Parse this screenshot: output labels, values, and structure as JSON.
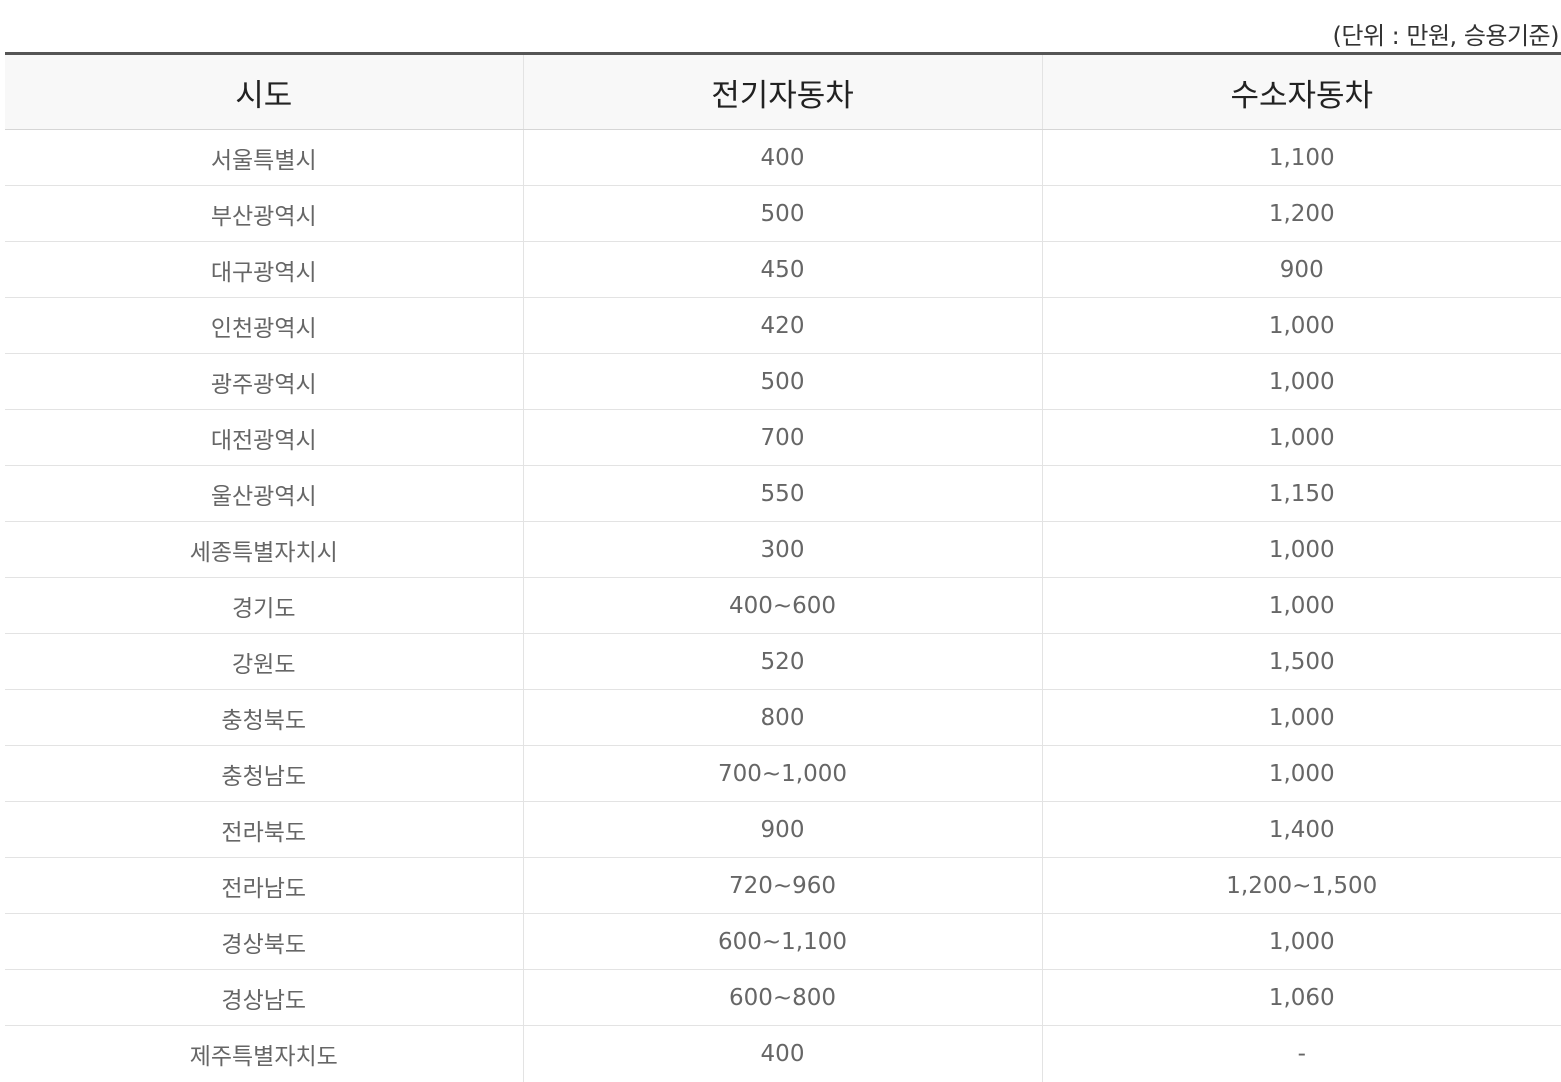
{
  "unit_note": "(단위 : 만원, 승용기준)",
  "table": {
    "headers": [
      "시도",
      "전기자동차",
      "수소자동차"
    ],
    "rows": [
      [
        "서울특별시",
        "400",
        "1,100"
      ],
      [
        "부산광역시",
        "500",
        "1,200"
      ],
      [
        "대구광역시",
        "450",
        "900"
      ],
      [
        "인천광역시",
        "420",
        "1,000"
      ],
      [
        "광주광역시",
        "500",
        "1,000"
      ],
      [
        "대전광역시",
        "700",
        "1,000"
      ],
      [
        "울산광역시",
        "550",
        "1,150"
      ],
      [
        "세종특별자치시",
        "300",
        "1,000"
      ],
      [
        "경기도",
        "400~600",
        "1,000"
      ],
      [
        "강원도",
        "520",
        "1,500"
      ],
      [
        "충청북도",
        "800",
        "1,000"
      ],
      [
        "충청남도",
        "700~1,000",
        "1,000"
      ],
      [
        "전라북도",
        "900",
        "1,400"
      ],
      [
        "전라남도",
        "720~960",
        "1,200~1,500"
      ],
      [
        "경상북도",
        "600~1,100",
        "1,000"
      ],
      [
        "경상남도",
        "600~800",
        "1,060"
      ],
      [
        "제주특별자치도",
        "400",
        "-"
      ]
    ]
  }
}
